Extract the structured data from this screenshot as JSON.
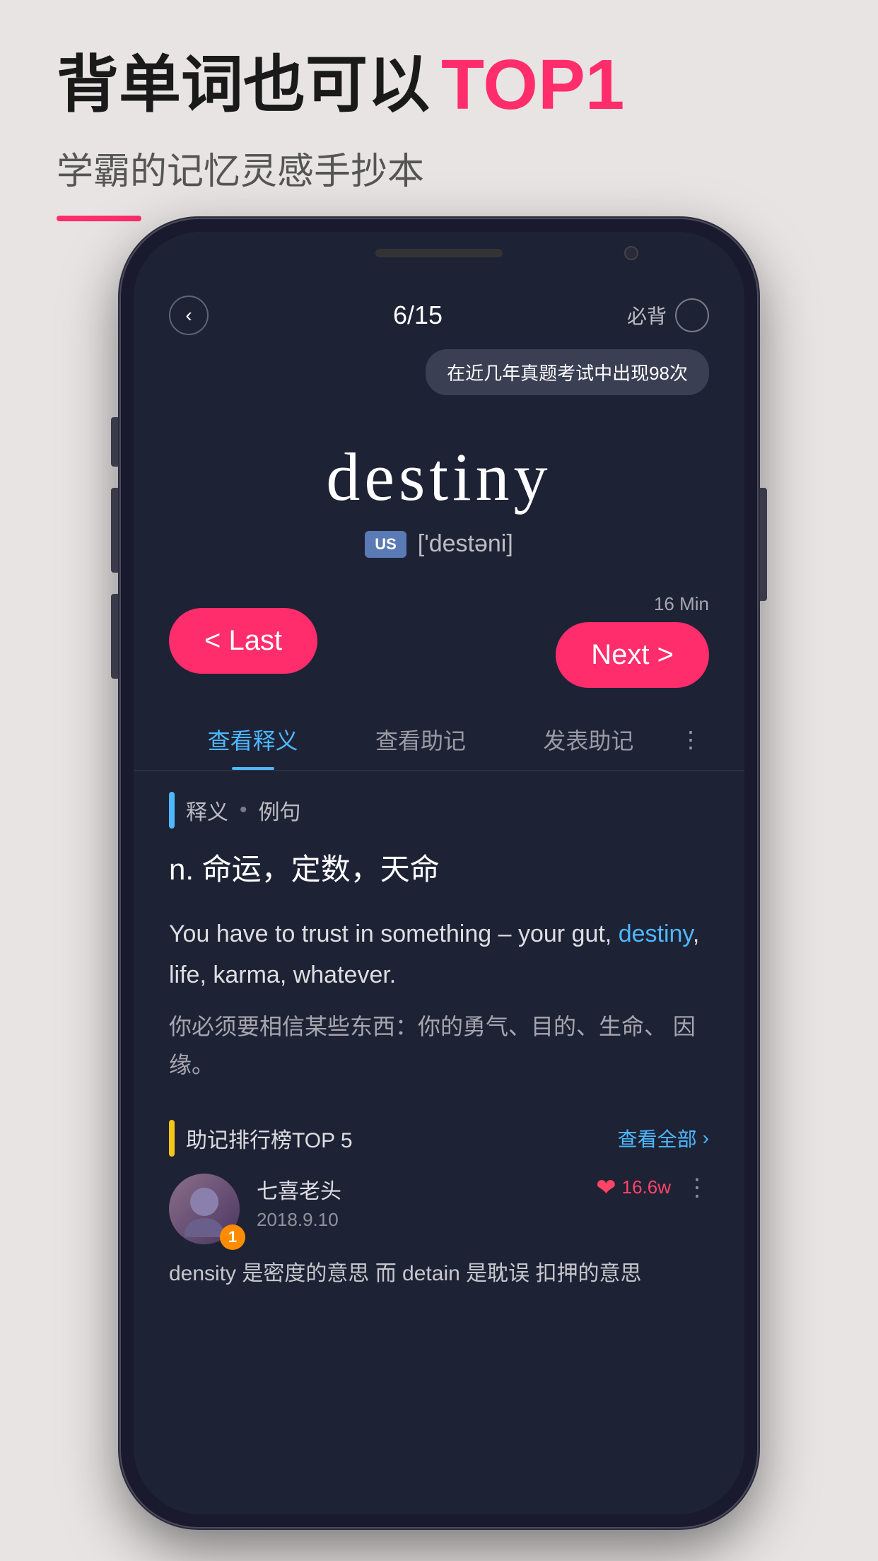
{
  "header": {
    "title_part1": "背单词也可以",
    "title_top1": "TOP1",
    "subtitle": "学霸的记忆灵感手抄本"
  },
  "phone": {
    "progress": "6/15",
    "must_memorize": "必背",
    "tooltip": "在近几年真题考试中出现98次",
    "word": "destiny",
    "phonetic_region": "US",
    "phonetic": "['destəni]",
    "time_label": "16 Min",
    "btn_last": "< Last",
    "btn_next": "Next >",
    "tabs": [
      {
        "label": "查看释义",
        "active": true
      },
      {
        "label": "查看助记",
        "active": false
      },
      {
        "label": "发表助记",
        "active": false
      }
    ],
    "section_header": "释义 • 例句",
    "definition": "n.  命运，定数，天命",
    "example_en_before": "You have to trust in something –\nyour gut, ",
    "example_en_highlight": "destiny",
    "example_en_after": ", life, karma, whatever.",
    "example_cn": "你必须要相信某些东西：你的勇气、目的、生命、\n因缘。",
    "ranking_title": "助记排行榜TOP 5",
    "view_all": "查看全部",
    "user": {
      "name": "七喜老头",
      "date": "2018.9.10",
      "likes": "16.6w",
      "rank": "1"
    },
    "mnemonic_text": "density 是密度的意思  而 detain 是耽误\n扣押的意思"
  },
  "colors": {
    "accent": "#ff2d6b",
    "blue": "#4db8ff",
    "bg_dark": "#1e2235",
    "yellow": "#f5c518"
  }
}
